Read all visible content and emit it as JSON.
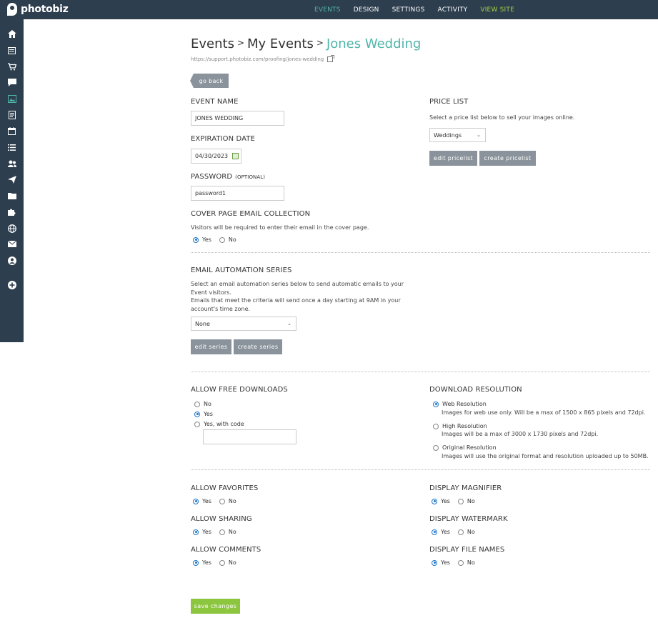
{
  "app": {
    "logo_text": "photobiz"
  },
  "topnav": [
    {
      "label": "EVENTS",
      "state": "active"
    },
    {
      "label": "DESIGN",
      "state": ""
    },
    {
      "label": "SETTINGS",
      "state": ""
    },
    {
      "label": "ACTIVITY",
      "state": ""
    },
    {
      "label": "VIEW SITE",
      "state": "view"
    }
  ],
  "sidebar_icons": [
    "home-icon",
    "page-icon",
    "cart-icon",
    "chat-icon",
    "gallery-icon",
    "document-icon",
    "calendar-icon",
    "list-icon",
    "users-icon",
    "send-icon",
    "folder-icon",
    "puzzle-icon",
    "globe-icon",
    "mail-icon",
    "user-circle-icon",
    "add-circle-icon"
  ],
  "breadcrumb": {
    "part1": "Events",
    "part2": "My Events",
    "current": "Jones Wedding",
    "sep": ">"
  },
  "url": "https://support.photobiz.com/proofing/jones-wedding",
  "go_back": "go back",
  "event_name": {
    "label": "EVENT NAME",
    "value": "JONES WEDDING"
  },
  "expiration": {
    "label": "EXPIRATION DATE",
    "value": "04/30/2023"
  },
  "password": {
    "label": "PASSWORD",
    "optional": "(OPTIONAL)",
    "value": "password1"
  },
  "cover_email": {
    "label": "COVER PAGE EMAIL COLLECTION",
    "desc": "Visitors will be required to enter their email in the cover page.",
    "yes": "Yes",
    "no": "No"
  },
  "price_list": {
    "label": "PRICE LIST",
    "desc": "Select a price list below to sell your images online.",
    "selected": "Weddings",
    "edit": "edit pricelist",
    "create": "create pricelist"
  },
  "email_series": {
    "label": "EMAIL AUTOMATION SERIES",
    "desc1": "Select an email automation series below to send automatic emails to your Event visitors.",
    "desc2": "Emails that meet the criteria will send once a day starting at 9AM in your account's time zone.",
    "selected": "None",
    "edit": "edit series",
    "create": "create series"
  },
  "free_downloads": {
    "label": "ALLOW FREE DOWNLOADS",
    "opt_no": "No",
    "opt_yes": "Yes",
    "opt_code": "Yes, with code",
    "code_value": ""
  },
  "resolution": {
    "label": "DOWNLOAD RESOLUTION",
    "web": "Web Resolution",
    "web_desc": "Images for web use only. Will be a max of 1500 x 865 pixels and 72dpi.",
    "high": "High Resolution",
    "high_desc": "Images will be a max of 3000 x 1730 pixels and 72dpi.",
    "orig": "Original Resolution",
    "orig_desc": "Images will use the original format and resolution uploaded up to 50MB."
  },
  "toggles": {
    "favorites": "ALLOW FAVORITES",
    "sharing": "ALLOW SHARING",
    "comments": "ALLOW COMMENTS",
    "magnifier": "DISPLAY MAGNIFIER",
    "watermark": "DISPLAY WATERMARK",
    "filenames": "DISPLAY FILE NAMES",
    "yes": "Yes",
    "no": "No"
  },
  "save": "save changes"
}
